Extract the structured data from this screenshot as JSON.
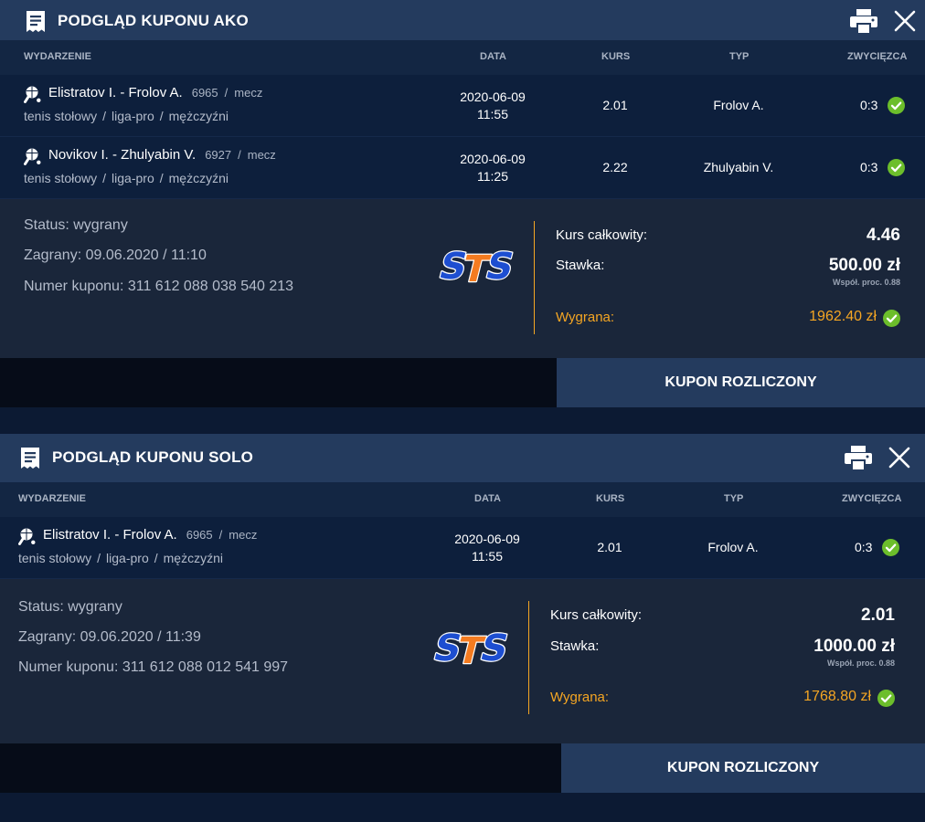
{
  "colors": {
    "header_bg": "#243b5e",
    "row_bg": "#0d1f3c",
    "summary_bg": "#1a263a",
    "accent_orange": "#f5a623",
    "check_green": "#6cbe2b",
    "sts_blue": "#1d4ed1",
    "sts_orange": "#f47b20"
  },
  "columns": {
    "event": "WYDARZENIE",
    "date": "DATA",
    "odds": "KURS",
    "type": "TYP",
    "winner": "ZWYCIĘZCA"
  },
  "labels": {
    "total_odds": "Kurs całkowity:",
    "stake": "Stawka:",
    "win": "Wygrana:",
    "settled_button": "KUPON ROZLICZONY",
    "sep": "/"
  },
  "icons": {
    "receipt": "receipt-icon",
    "print": "printer-icon",
    "close": "close-icon",
    "sport": "table-tennis-icon",
    "check": "check-circle-icon",
    "logo": "STS"
  },
  "coupons": [
    {
      "title": "PODGLĄD KUPONU AKO",
      "events": [
        {
          "name": "Elistratov I. - Frolov A.",
          "number": "6965",
          "kind": "mecz",
          "cat1": "tenis stołowy",
          "cat2": "liga-pro",
          "cat3": "mężczyźni",
          "date": "2020-06-09",
          "time": "11:55",
          "odds": "2.01",
          "type": "Frolov A.",
          "result": "0:3"
        },
        {
          "name": "Novikov I. - Zhulyabin V.",
          "number": "6927",
          "kind": "mecz",
          "cat1": "tenis stołowy",
          "cat2": "liga-pro",
          "cat3": "mężczyźni",
          "date": "2020-06-09",
          "time": "11:25",
          "odds": "2.22",
          "type": "Zhulyabin V.",
          "result": "0:3"
        }
      ],
      "status": "Status: wygrany",
      "played": "Zagrany: 09.06.2020 / 11:10",
      "coupon_number": "Numer kuponu: 311 612 088 038 540 213",
      "total_odds": "4.46",
      "stake": "500.00 zł",
      "stake_note": "Współ. proc. 0.88",
      "win": "1962.40 zł"
    },
    {
      "title": "PODGLĄD KUPONU SOLO",
      "events": [
        {
          "name": "Elistratov I. - Frolov A.",
          "number": "6965",
          "kind": "mecz",
          "cat1": "tenis stołowy",
          "cat2": "liga-pro",
          "cat3": "mężczyźni",
          "date": "2020-06-09",
          "time": "11:55",
          "odds": "2.01",
          "type": "Frolov A.",
          "result": "0:3"
        }
      ],
      "status": "Status: wygrany",
      "played": "Zagrany: 09.06.2020 / 11:39",
      "coupon_number": "Numer kuponu: 311 612 088 012 541 997",
      "total_odds": "2.01",
      "stake": "1000.00 zł",
      "stake_note": "Współ. proc. 0.88",
      "win": "1768.80 zł"
    }
  ]
}
